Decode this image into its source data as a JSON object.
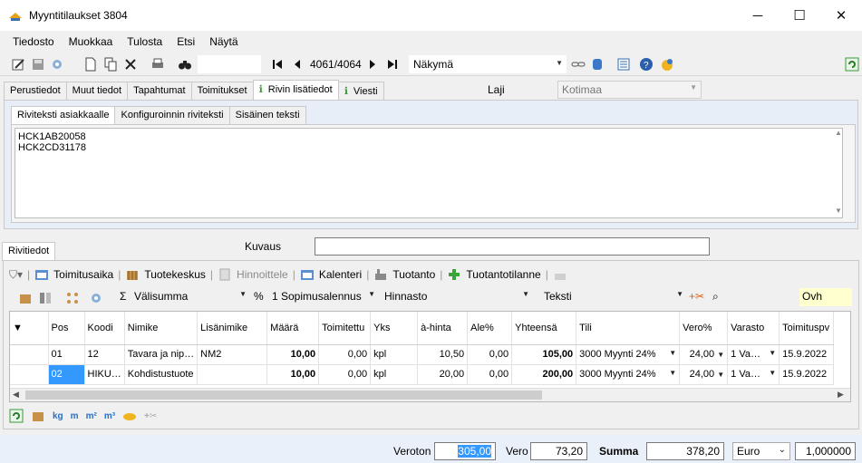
{
  "window": {
    "title": "Myyntitilaukset 3804"
  },
  "menu": [
    "Tiedosto",
    "Muokkaa",
    "Tulosta",
    "Etsi",
    "Näytä"
  ],
  "toolbar": {
    "record_nav": "4061/4064",
    "view_combo": "Näkymä"
  },
  "tabs": [
    "Perustiedot",
    "Muut tiedot",
    "Tapahtumat",
    "Toimitukset",
    "Rivin lisätiedot",
    "Viesti"
  ],
  "laji": {
    "label": "Laji",
    "value": "Kotimaa"
  },
  "subtabs": [
    "Riviteksti asiakkaalle",
    "Konfiguroinnin riviteksti",
    "Sisäinen teksti"
  ],
  "riviteksti": [
    "HCK1AB20058",
    "HCK2CD31178"
  ],
  "rivitiedot": {
    "tab": "Rivitiedot",
    "kuvaus_label": "Kuvaus",
    "kuvaus_value": ""
  },
  "row_toolbar1": [
    "Toimitusaika",
    "Tuotekeskus",
    "Hinnoittele",
    "Kalenteri",
    "Tuotanto",
    "Tuotantotilanne"
  ],
  "row_toolbar2": {
    "valisumma": "Välisumma",
    "percent": "%",
    "sopimus": "1 Sopimusalennus",
    "hinnasto": "Hinnasto",
    "teksti": "Teksti",
    "ovh": "Ovh"
  },
  "grid": {
    "columns": [
      "Pos",
      "Koodi",
      "Nimike",
      "Lisänimike",
      "Määrä",
      "Toimitettu",
      "Yks",
      "à-hinta",
      "Ale%",
      "Yhteensä",
      "Tili",
      "Vero%",
      "Varasto",
      "Toimituspv"
    ],
    "rows": [
      [
        "01",
        "12",
        "Tavara ja nip…",
        "NM2",
        "10,00",
        "0,00",
        "kpl",
        "10,50",
        "0,00",
        "105,00",
        "3000 Myynti 24%",
        "24,00",
        "1 Va…",
        "15.9.2022"
      ],
      [
        "02",
        "HIKU…",
        "Kohdistustuote",
        "",
        "10,00",
        "0,00",
        "kpl",
        "20,00",
        "0,00",
        "200,00",
        "3000 Myynti 24%",
        "24,00",
        "1 Va…",
        "15.9.2022"
      ]
    ]
  },
  "bottom_toolbar": [
    "kg",
    "m",
    "m²",
    "m³"
  ],
  "totals": {
    "veroton_label": "Veroton",
    "veroton": "305,00",
    "vero_label": "Vero",
    "vero": "73,20",
    "summa_label": "Summa",
    "summa": "378,20",
    "currency": "Euro",
    "rate": "1,000000"
  }
}
